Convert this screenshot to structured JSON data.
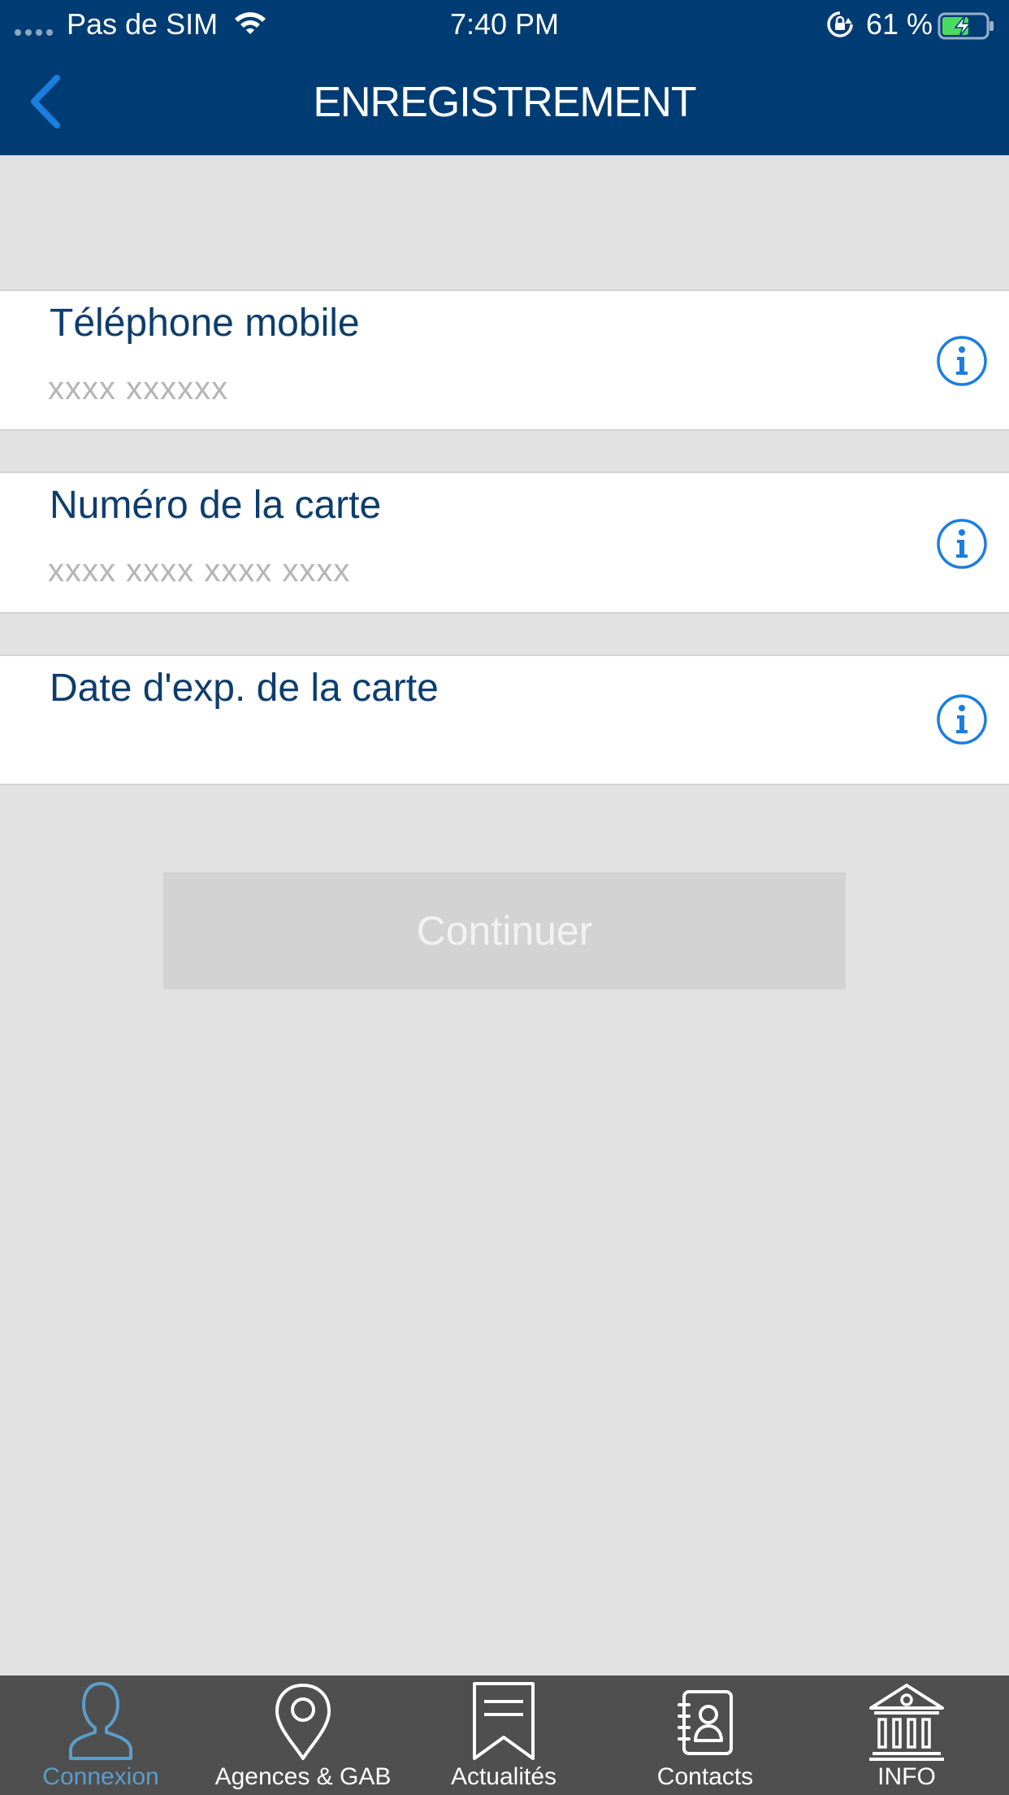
{
  "status_bar": {
    "carrier": "Pas de SIM",
    "time": "7:40 PM",
    "battery": "61 %"
  },
  "nav": {
    "title": "ENREGISTREMENT"
  },
  "form": {
    "phone": {
      "label": "Téléphone mobile",
      "placeholder": "xxxx xxxxxx",
      "value": ""
    },
    "card_number": {
      "label": "Numéro de la carte",
      "placeholder": "xxxx xxxx xxxx xxxx",
      "value": ""
    },
    "card_expiry": {
      "label": "Date d'exp. de la carte",
      "value": ""
    }
  },
  "continue_label": "Continuer",
  "tabs": [
    {
      "label": "Connexion",
      "icon": "user-icon",
      "active": true
    },
    {
      "label": "Agences & GAB",
      "icon": "map-pin-icon",
      "active": false
    },
    {
      "label": "Actualités",
      "icon": "bookmark-icon",
      "active": false
    },
    {
      "label": "Contacts",
      "icon": "address-book-icon",
      "active": false
    },
    {
      "label": "INFO",
      "icon": "bank-icon",
      "active": false
    }
  ],
  "colors": {
    "header": "#003c74",
    "accent": "#1a7ee0",
    "tab_active": "#5b9ec9",
    "tab_bar": "#4f4f4f",
    "background": "#e2e2e2"
  }
}
